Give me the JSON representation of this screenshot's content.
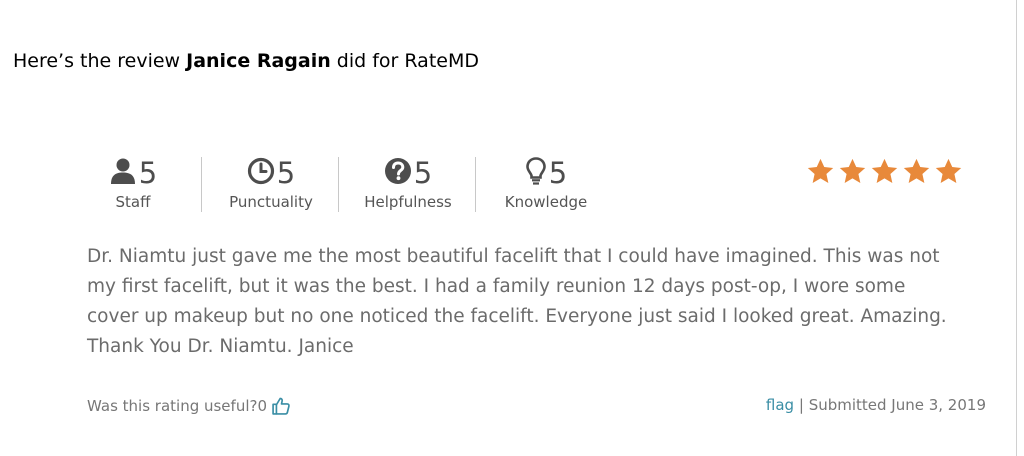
{
  "intro": {
    "prefix": "Here’s the review ",
    "name": "Janice Ragain",
    "suffix": " did for RateMD"
  },
  "ratings": [
    {
      "label": "Staff",
      "value": "5",
      "icon": "person-icon"
    },
    {
      "label": "Punctuality",
      "value": "5",
      "icon": "clock-icon"
    },
    {
      "label": "Helpfulness",
      "value": "5",
      "icon": "question-icon"
    },
    {
      "label": "Knowledge",
      "value": "5",
      "icon": "lightbulb-icon"
    }
  ],
  "stars": {
    "value": 5,
    "max": 5,
    "color": "#e8893a"
  },
  "review": {
    "lines": [
      "Dr. Niamtu just gave me the most beautiful facelift that I could have imagined. This was not",
      "my first facelift, but it was the best. I had a family reunion 12 days post-op, I wore some",
      "cover up makeup but no one noticed the facelift. Everyone just said I looked great. Amazing.",
      "Thank You Dr. Niamtu. Janice"
    ]
  },
  "footer": {
    "useful_label": "Was this rating useful?",
    "useful_count": "0",
    "flag": "flag",
    "divider": " | ",
    "submitted": "Submitted June 3, 2019"
  },
  "colors": {
    "accent": "#3a8ea5",
    "icon": "#4d4d4d",
    "text": "#6b6b6b"
  }
}
